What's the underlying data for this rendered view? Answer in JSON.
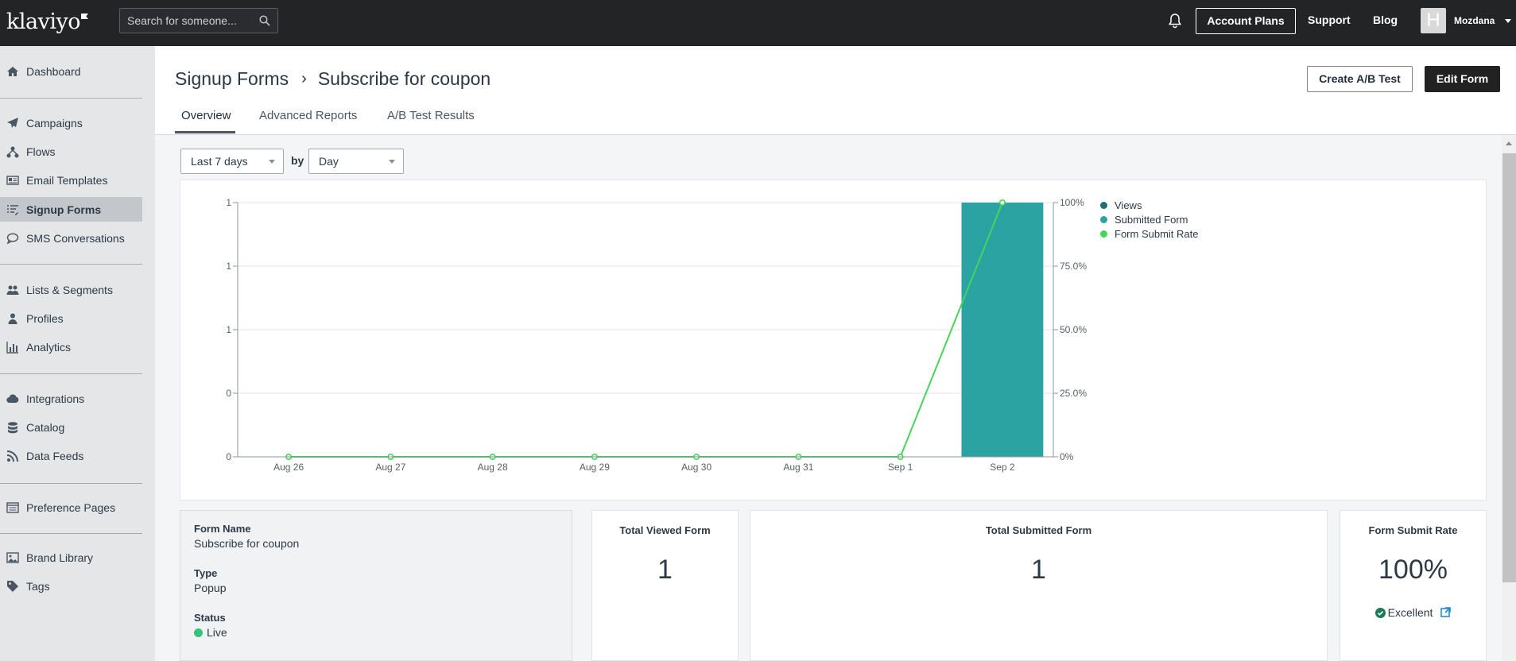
{
  "topbar": {
    "logo": "klaviyo",
    "search_placeholder": "Search for someone...",
    "account_plans": "Account Plans",
    "support": "Support",
    "blog": "Blog",
    "avatar_initial": "H",
    "user_name": "Mozdana"
  },
  "sidebar": {
    "items": [
      {
        "label": "Dashboard",
        "icon": "home-icon"
      },
      {
        "label": "Campaigns",
        "icon": "paper-plane-icon"
      },
      {
        "label": "Flows",
        "icon": "flows-icon"
      },
      {
        "label": "Email Templates",
        "icon": "template-icon"
      },
      {
        "label": "Signup Forms",
        "icon": "form-list-icon",
        "active": true
      },
      {
        "label": "SMS Conversations",
        "icon": "chat-icon"
      },
      {
        "label": "Lists & Segments",
        "icon": "users-icon"
      },
      {
        "label": "Profiles",
        "icon": "user-icon"
      },
      {
        "label": "Analytics",
        "icon": "bar-chart-icon"
      },
      {
        "label": "Integrations",
        "icon": "cloud-icon"
      },
      {
        "label": "Catalog",
        "icon": "database-icon"
      },
      {
        "label": "Data Feeds",
        "icon": "rss-icon"
      },
      {
        "label": "Preference Pages",
        "icon": "page-icon"
      },
      {
        "label": "Brand Library",
        "icon": "image-icon"
      },
      {
        "label": "Tags",
        "icon": "tag-icon"
      }
    ]
  },
  "header": {
    "breadcrumb_parent": "Signup Forms",
    "breadcrumb_separator": "›",
    "title": "Subscribe for coupon",
    "create_ab_test": "Create A/B Test",
    "edit_form": "Edit Form",
    "tabs": [
      {
        "label": "Overview",
        "active": true
      },
      {
        "label": "Advanced Reports"
      },
      {
        "label": "A/B Test Results"
      }
    ]
  },
  "filters": {
    "range": "Last 7 days",
    "by_label": "by",
    "granularity": "Day"
  },
  "chart_data": {
    "type": "bar",
    "categories": [
      "Aug 26",
      "Aug 27",
      "Aug 28",
      "Aug 29",
      "Aug 30",
      "Aug 31",
      "Sep 1",
      "Sep 2"
    ],
    "series": [
      {
        "name": "Views",
        "type": "bar",
        "color": "#1f6f78",
        "values": [
          0,
          0,
          0,
          0,
          0,
          0,
          0,
          1
        ]
      },
      {
        "name": "Submitted Form",
        "type": "bar",
        "color": "#2ba3a3",
        "values": [
          0,
          0,
          0,
          0,
          0,
          0,
          0,
          1
        ]
      },
      {
        "name": "Form Submit Rate",
        "type": "line",
        "axis": "right",
        "color": "#44d65a",
        "values": [
          0,
          0,
          0,
          0,
          0,
          0,
          0,
          100
        ]
      }
    ],
    "y_left_ticks": [
      "1",
      "1",
      "1",
      "0",
      "0"
    ],
    "y_right_ticks": [
      "100%",
      "75.0%",
      "50.0%",
      "25.0%",
      "0%"
    ],
    "ylim_left": [
      0,
      1
    ],
    "ylim_right": [
      0,
      100
    ],
    "grid": true,
    "legend_position": "top-right"
  },
  "info": {
    "form_name_label": "Form Name",
    "form_name": "Subscribe for coupon",
    "type_label": "Type",
    "type": "Popup",
    "status_label": "Status",
    "status": "Live",
    "status_color": "#35c27d"
  },
  "metrics": {
    "total_viewed_label": "Total Viewed Form",
    "total_viewed": "1",
    "total_submitted_label": "Total Submitted Form",
    "total_submitted": "1",
    "submit_rate_label": "Form Submit Rate",
    "submit_rate": "100%",
    "rating": "Excellent"
  },
  "colors": {
    "topbar": "#232426",
    "accent_teal": "#2ba3a3",
    "line_green": "#44d65a"
  }
}
